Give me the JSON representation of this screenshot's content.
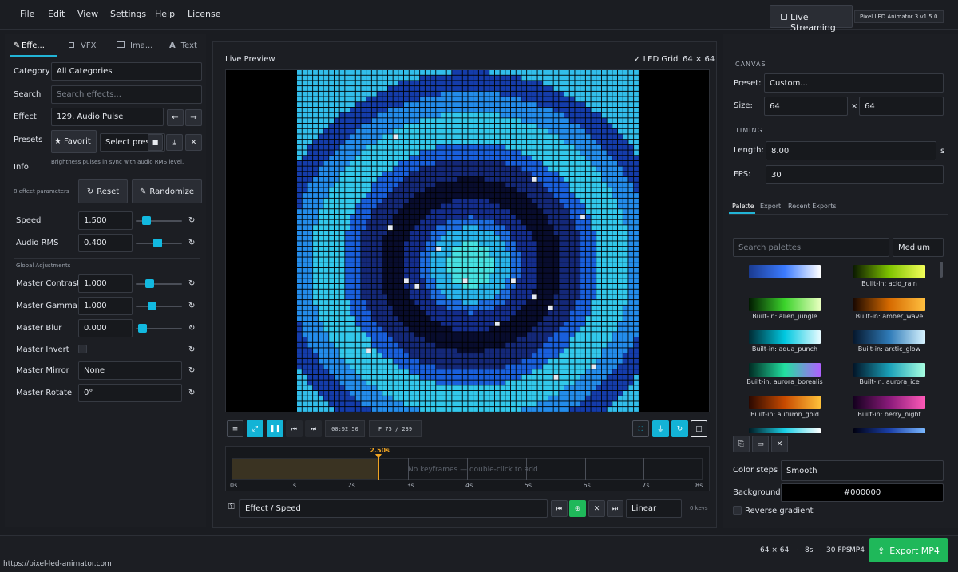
{
  "menu": [
    "File",
    "Edit",
    "View",
    "Settings",
    "Help",
    "License"
  ],
  "header": {
    "live_streaming": "Live Streaming",
    "app_version": "Pixel LED Animator 3  v1.5.0"
  },
  "left_tabs": [
    "Effe...",
    "VFX",
    "Ima...",
    "Text"
  ],
  "left": {
    "category_label": "Category",
    "category_value": "All Categories",
    "search_label": "Search",
    "search_placeholder": "Search effects...",
    "effect_label": "Effect",
    "effect_value": "129. Audio Pulse",
    "presets_label": "Presets",
    "favorite": "Favorit",
    "select_preset": "Select prese",
    "info_label": "Info",
    "info_text": "Brightness pulses in sync with audio RMS level.",
    "param_count": "8 effect parameters",
    "reset": "Reset",
    "randomize": "Randomize",
    "params": [
      {
        "name": "Speed",
        "value": "1.500",
        "level": 0.1
      },
      {
        "name": "Audio RMS",
        "value": "0.400",
        "level": 0.4
      }
    ],
    "global_title": "Global Adjustments",
    "global": [
      {
        "name": "Master Contrast",
        "value": "1.000",
        "level": 0.2
      },
      {
        "name": "Master Gamma",
        "value": "1.000",
        "level": 0.25
      },
      {
        "name": "Master Blur",
        "value": "0.000",
        "level": 0.0
      }
    ],
    "invert_label": "Master Invert",
    "mirror_label": "Master Mirror",
    "mirror_value": "None",
    "rotate_label": "Master Rotate",
    "rotate_value": "0°"
  },
  "center": {
    "title": "Live Preview",
    "led_grid": "LED Grid",
    "dims": "64 × 64",
    "time": "00:02.50",
    "frame": "F 75 / 239",
    "playhead": "2.50s",
    "playhead_fraction": 0.3125,
    "no_keyframes": "No keyframes — double-click to add",
    "ticks": [
      "0s",
      "1s",
      "2s",
      "3s",
      "4s",
      "5s",
      "6s",
      "7s",
      "8s"
    ],
    "track": "Effect / Speed",
    "interp": "Linear",
    "keys": "0 keys"
  },
  "right": {
    "canvas_title": "CANVAS",
    "preset_label": "Preset:",
    "preset_value": "Custom...",
    "size_label": "Size:",
    "width": "64",
    "x": "×",
    "height": "64",
    "timing_title": "TIMING",
    "length_label": "Length:",
    "length_value": "8.00",
    "length_unit": "s",
    "fps_label": "FPS:",
    "fps_value": "30",
    "tabs": [
      "Palette",
      "Export",
      "Recent Exports"
    ],
    "search_placeholder": "Search palettes",
    "size_select": "Medium",
    "palettes": [
      {
        "name": "",
        "colors": [
          "#1a3a8f",
          "#3b7bff",
          "#ffffff"
        ]
      },
      {
        "name": "Built-in: acid_rain",
        "colors": [
          "#0b1a00",
          "#7fc400",
          "#f4ff5a"
        ]
      },
      {
        "name": "Built-in: alien_jungle",
        "colors": [
          "#001a00",
          "#3bd32b",
          "#e9ffc0"
        ]
      },
      {
        "name": "Built-in: amber_wave",
        "colors": [
          "#1a0800",
          "#d66a00",
          "#ffc040"
        ]
      },
      {
        "name": "Built-in: aqua_punch",
        "colors": [
          "#002a33",
          "#00c8e0",
          "#e8fbff"
        ]
      },
      {
        "name": "Built-in: arctic_glow",
        "colors": [
          "#06182e",
          "#2f7bb8",
          "#d8f4ff"
        ]
      },
      {
        "name": "Built-in: aurora_borealis",
        "colors": [
          "#002a22",
          "#22e0a0",
          "#b060ff"
        ]
      },
      {
        "name": "Built-in: aurora_ice",
        "colors": [
          "#021528",
          "#1aa0b8",
          "#a8ffe0"
        ]
      },
      {
        "name": "Built-in: autumn_gold",
        "colors": [
          "#2a0800",
          "#c84a00",
          "#ffc23a"
        ]
      },
      {
        "name": "Built-in: berry_night",
        "colors": [
          "#14001e",
          "#8a1a7a",
          "#ff5ab8"
        ]
      },
      {
        "name": "",
        "colors": [
          "#001a22",
          "#1ad0e6",
          "#ffffff"
        ]
      },
      {
        "name": "",
        "colors": [
          "#000010",
          "#1a3fa8",
          "#7ab8ff"
        ]
      }
    ],
    "color_steps_label": "Color steps",
    "color_steps_value": "Smooth",
    "background_label": "Background",
    "background_value": "#000000",
    "reverse_label": "Reverse gradient"
  },
  "bottom": {
    "dims": "64 × 64",
    "length": "8s",
    "fps": "30 FPS",
    "format": "MP4",
    "export": "Export MP4",
    "url": "https://pixel-led-animator.com"
  }
}
